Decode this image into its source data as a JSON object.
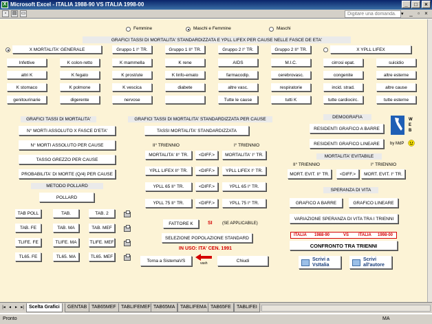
{
  "window": {
    "title": "Microsoft Excel - ITALIA 1988-90 VS ITALIA 1998-00",
    "app_icon": "excel-icon"
  },
  "toolbar": {
    "help_placeholder": "Digitare una domanda."
  },
  "sex": {
    "female": "Femmine",
    "both": "Maschi e Femmine",
    "male": "Maschi",
    "selected": "both"
  },
  "main_header": "GRAFICI TASSI DI MORTALITA' STANDARDIZZATA E YPLL LIFEX PER CAUSE NELLE FASCE DE ETA'",
  "general": {
    "mortality_general": "X MORTALITA' GENERALE",
    "ypll_lifex": "X YPLL LIFEX"
  },
  "groups": [
    "Gruppo 1 I° TR.",
    "Gruppo 1 II° TR.",
    "Gruppo 2 I° TR.",
    "Gruppo 2 II° TR."
  ],
  "causes": [
    [
      "Infettive",
      "K colon-retto",
      "K mammella",
      "K rene",
      "AIDS",
      "M.I.C.",
      "cirrosi epat.",
      "suicidio"
    ],
    [
      "altri K",
      "K fegato",
      "K prost/ute",
      "K linfo-emato",
      "farmacodip.",
      "cerebrovasc.",
      "congenite",
      "altre esterne"
    ],
    [
      "K stomaco",
      "K polmone",
      "K vescica",
      "diabete",
      "altre vasc.",
      "respiratorie",
      "incid. strad.",
      "altre cause"
    ],
    [
      "genitourinarie",
      "digerente",
      "nervose",
      "",
      "Tutte le cause",
      "tutti K",
      "tutte cardiocirc.",
      "tutte esterne"
    ]
  ],
  "left_panel": {
    "title": "GRAFICI TASSI DI MORTALITA'",
    "buttons": [
      "N° MORTI ASSOLUTO X FASCE D'ETA'",
      "N° MORTI ASSOLUTO PER CAUSE",
      "TASSO GREZZO PER CAUSE",
      "PROBABILITA' DI MORTE (Q/4) PER CAUSE"
    ],
    "pollard_title": "METODO POLLARD",
    "pollard": "POLLARD",
    "tables": [
      [
        "TAB POLL",
        "TAB.",
        "TAB. 2"
      ],
      [
        "TAB. FE",
        "TAB. MA",
        "TAB. MEF"
      ],
      [
        "TLIFE. FE",
        "TLIFE. MA",
        "TLIFE. MEF"
      ],
      [
        "TL65. FE",
        "TL65. MA",
        "TL65. MEF"
      ]
    ]
  },
  "center_panel": {
    "title": "GRAFICI TASSI DI MORTALITA' STANDARDIZZATA PER CAUSE",
    "std_button": "TASSI MORTALITA' STANDARDIZZATA",
    "second_triennium": "II° TRIENNIO",
    "first_triennium": "I° TRIENNIO",
    "rows": [
      [
        "MORTALITA' II° TR.",
        "<DIFF.>",
        "MORTALITA' I° TR."
      ],
      [
        "YPLL LIFEX II° TR.",
        "<DIFF.>",
        "YPLL LIFEX I° TR."
      ],
      [
        "YPLL 65 II° TR.",
        "<DIFF.>",
        "YPLL 65 I° TR."
      ],
      [
        "YPLL 75 II° TR.",
        "<DIFF.>",
        "YPLL 75 I° TR."
      ]
    ],
    "factor_k": "FATTORE K",
    "si": "SI",
    "if_applicable": "(SE APPLICABILE)",
    "select_population": "SELEZIONE POPOLAZIONE STANDARD",
    "in_use": "IN USO:  ITA' CEN. 1991",
    "back_button": "Torna a SistemaVS",
    "back_caption": "vash",
    "close_button": "Chiudi"
  },
  "right_panel": {
    "demography_title": "DEMOGRAFIA",
    "resident_bar": "RESIDENTI GRAFICO A BARRE",
    "resident_line": "RESIDENTI GRAFICO LINEARE",
    "web_label": "W E B",
    "by_label": "by MdP",
    "avoidable_title": "MORTALITA' EVITABILE",
    "av_second": "II° TRIENNIO",
    "av_first": "I° TRIENNIO",
    "av_buttons": [
      "MORT. EVIT. II° TR.",
      "<DIFF.>",
      "MORT. EVIT. I° TR."
    ],
    "life_title": "SPERANZA DI VITA",
    "life_bar": "GRAFICO A BARRE",
    "life_line": "GRAFICO LINEARE",
    "life_variation": "VARIAZIONE SPERANZA DI VITA TRA I TRIENNI",
    "compare": [
      "ITALIA",
      "1988-90",
      "VS",
      "ITALIA",
      "1998-00"
    ],
    "compare_button": "CONFRONTO TRA TRIENNI",
    "write_vsitalia": "Scrivi a VsItalia",
    "write_author": "Scrivi all'autore"
  },
  "sheet_tabs": [
    "Scelta Grafici",
    "GENTAB",
    "TAB65MEF",
    "TABLIFEMEF",
    "TAB65MA",
    "TABLIFEMA",
    "TAB65FE",
    "TABLIFEI"
  ],
  "status": {
    "ready": "Pronto",
    "mode": "MA"
  }
}
